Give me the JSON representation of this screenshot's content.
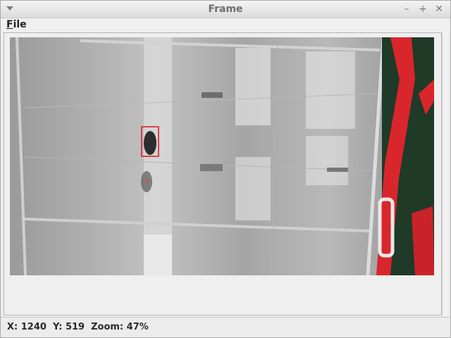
{
  "window": {
    "title": "Frame"
  },
  "menubar": {
    "items": [
      {
        "label": "File",
        "mnemonic": "F",
        "rest": "ile"
      }
    ]
  },
  "status": {
    "x_label": "X: 1240",
    "y_label": "Y: 519",
    "zoom_label": "Zoom: 47%"
  },
  "colors": {
    "detection_box": "#e0141e",
    "window_bg": "#eeeeee"
  },
  "icons": {
    "window_menu": "triangle-down-icon",
    "minimize": "minimize-icon",
    "maximize": "maximize-icon",
    "close": "close-icon"
  }
}
